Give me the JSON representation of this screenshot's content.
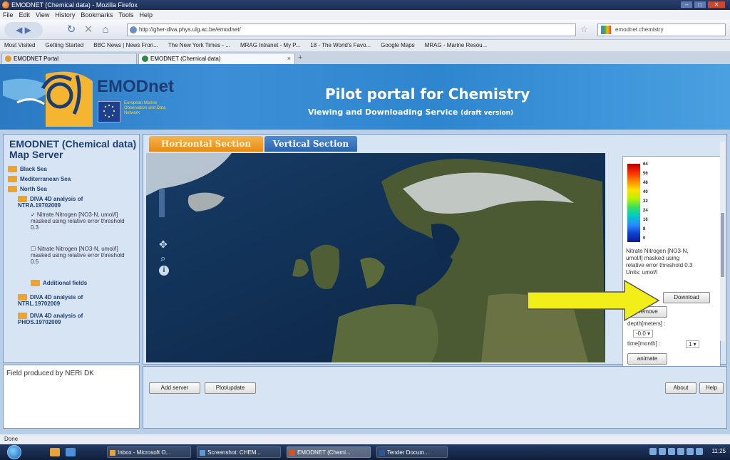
{
  "window": {
    "title": "EMODNET (Chemical data) - Mozilla Firefox"
  },
  "menubar": {
    "items": [
      "File",
      "Edit",
      "View",
      "History",
      "Bookmarks",
      "Tools",
      "Help"
    ]
  },
  "navbar": {
    "url": "http://gher-diva.phys.ulg.ac.be/emodnet/",
    "search": "emodnet chemistry"
  },
  "bookmarks": [
    "Most Visited",
    "Getting Started",
    "BBC News | News Fron...",
    "The New York Times - ...",
    "MRAG Intranet - My P...",
    "18 - The World's Favo...",
    "Google Maps",
    "MRAG - Marine Resou..."
  ],
  "tabs": [
    {
      "label": "EMODNET Portal"
    },
    {
      "label": "EMODNET (Chemical data)"
    }
  ],
  "header": {
    "logo": "EMODnet",
    "logo_sub": "European Marine Observation and Data Network",
    "title": "Pilot portal for Chemistry",
    "subtitle": "Viewing and Downloading Service",
    "subtitle_note": "(draft version)"
  },
  "sidebar": {
    "title": "EMODNET (Chemical data) Map Server",
    "tree": {
      "black_sea": "Black Sea",
      "med_sea": "Mediterranean Sea",
      "north_sea": "North Sea",
      "ntra": "DIVA 4D analysis of NTRA.19702009",
      "layer1": "✓ Nitrate Nitrogen [NO3-N, umol/l] masked using relative error threshold 0.3",
      "layer2": "☐ Nitrate Nitrogen [NO3-N, umol/l] masked using relative error threshold 0.5",
      "additional": "Additional fields",
      "ntrl": "DIVA 4D analysis of NTRL.19702009",
      "phos": "DIVA 4D analysis of PHOS.19702009"
    },
    "field_info": "Field produced by NERI DK"
  },
  "main": {
    "tab_horizontal": "Horizontal Section",
    "tab_vertical": "Vertical Section",
    "legend": {
      "ticks": [
        "64",
        "56",
        "48",
        "40",
        "32",
        "24",
        "16",
        "8",
        "0"
      ],
      "description": "Nitrate Nitrogen [NO3-N, umol/l] masked using relative error threshold 0.3 Units: umol/l"
    },
    "download": "Download",
    "remove": "Remove",
    "depth_label": "depth[meters] :",
    "depth_value": "-0.0",
    "time_label": "time[month] :",
    "time_value": "1",
    "animate": "animate",
    "add_server": "Add server",
    "plot_update": "Plot/update",
    "about": "About",
    "help": "Help"
  },
  "status": "Done",
  "taskbar": {
    "items": [
      "Inbox - Microsoft O...",
      "Screenshot: CHEM...",
      "EMODNET (Chemi...",
      "Tender Docum..."
    ],
    "clock": "11:25"
  },
  "colors": {
    "arrow": "#f2ee1a",
    "banner": "#2e86cf",
    "tab_active": "#e88a12"
  }
}
